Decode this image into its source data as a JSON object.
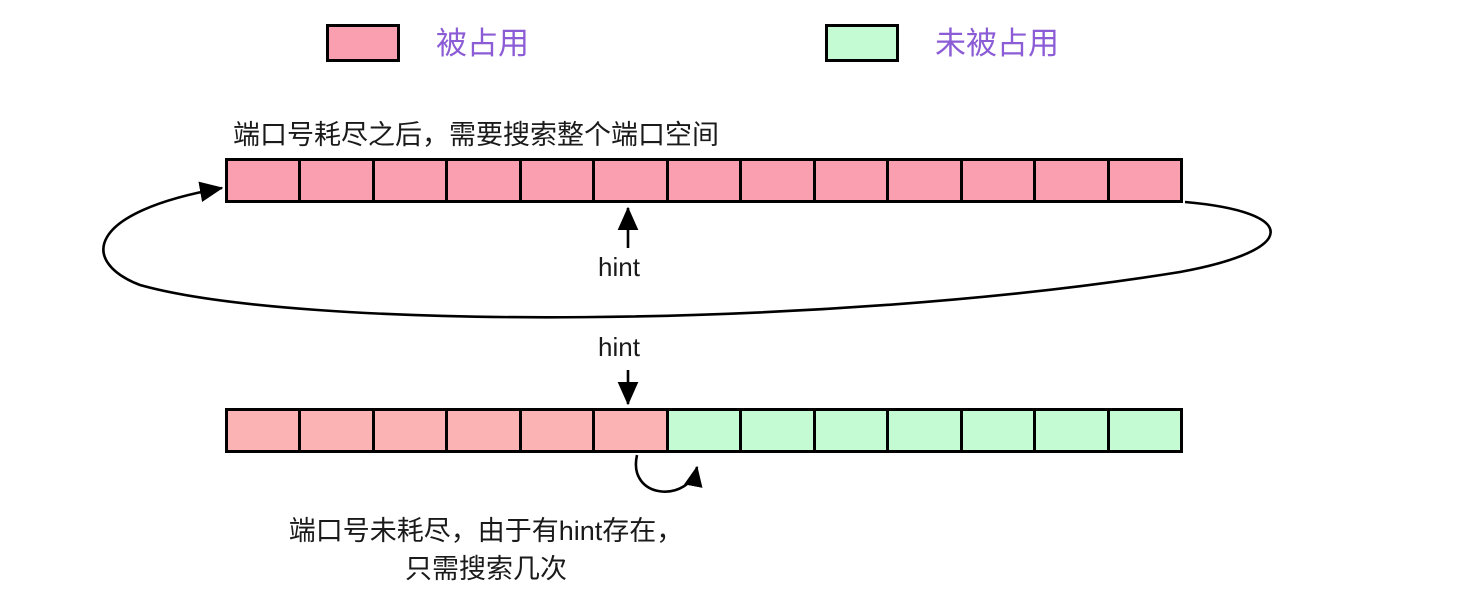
{
  "legend": {
    "items": [
      {
        "key": "occupied",
        "label": "被占用",
        "color": "#FA9FB0",
        "text_color": "#8B5CD6"
      },
      {
        "key": "free",
        "label": "未被占用",
        "color": "#C5FBD2",
        "text_color": "#8B5CD6"
      }
    ]
  },
  "top_section": {
    "caption": "端口号耗尽之后，需要搜索整个端口空间",
    "hint_label": "hint",
    "bar": {
      "total_cells": 13,
      "occupied_cells": 13,
      "free_cells": 0,
      "occupied_color": "#FA9FB0",
      "free_color": "#C5FBD2"
    },
    "wrap_arrow": "loops from right end of bar back to left start of bar"
  },
  "bottom_section": {
    "hint_label": "hint",
    "caption_line_1": "端口号未耗尽，由于有hint存在，",
    "caption_line_2": "只需搜索几次",
    "bar": {
      "total_cells": 13,
      "occupied_cells": 6,
      "free_cells": 7,
      "occupied_color": "#FCB3B3",
      "free_color": "#C5FBD2"
    },
    "search_arrow": "short curved arrow from hint boundary into free region"
  },
  "colors": {
    "stroke": "#000000",
    "text": "#1A1A1A",
    "accent_purple": "#8B5CD6",
    "background": "#FFFFFF"
  }
}
